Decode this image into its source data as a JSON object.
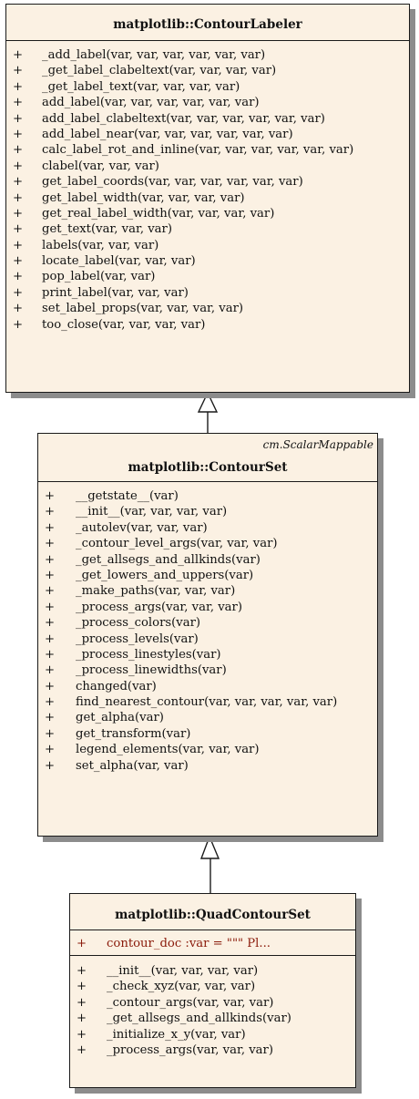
{
  "classes": {
    "contour_labeler": {
      "title": "matplotlib::ContourLabeler",
      "methods": [
        {
          "vis": "+",
          "sig": "_add_label(var, var, var, var, var, var)"
        },
        {
          "vis": "+",
          "sig": "_get_label_clabeltext(var, var, var, var)"
        },
        {
          "vis": "+",
          "sig": "_get_label_text(var, var, var, var)"
        },
        {
          "vis": "+",
          "sig": "add_label(var, var, var, var, var, var)"
        },
        {
          "vis": "+",
          "sig": "add_label_clabeltext(var, var, var, var, var, var)"
        },
        {
          "vis": "+",
          "sig": "add_label_near(var, var, var, var, var, var)"
        },
        {
          "vis": "+",
          "sig": "calc_label_rot_and_inline(var, var, var, var, var, var)"
        },
        {
          "vis": "+",
          "sig": "clabel(var, var, var)"
        },
        {
          "vis": "+",
          "sig": "get_label_coords(var, var, var, var, var, var)"
        },
        {
          "vis": "+",
          "sig": "get_label_width(var, var, var, var)"
        },
        {
          "vis": "+",
          "sig": "get_real_label_width(var, var, var, var)"
        },
        {
          "vis": "+",
          "sig": "get_text(var, var, var)"
        },
        {
          "vis": "+",
          "sig": "labels(var, var, var)"
        },
        {
          "vis": "+",
          "sig": "locate_label(var, var, var)"
        },
        {
          "vis": "+",
          "sig": "pop_label(var, var)"
        },
        {
          "vis": "+",
          "sig": "print_label(var, var, var)"
        },
        {
          "vis": "+",
          "sig": "set_label_props(var, var, var, var)"
        },
        {
          "vis": "+",
          "sig": "too_close(var, var, var, var)"
        }
      ]
    },
    "contour_set": {
      "stereotype": "cm.ScalarMappable",
      "title": "matplotlib::ContourSet",
      "methods": [
        {
          "vis": "+",
          "sig": "__getstate__(var)"
        },
        {
          "vis": "+",
          "sig": "__init__(var, var, var, var)"
        },
        {
          "vis": "+",
          "sig": "_autolev(var, var, var)"
        },
        {
          "vis": "+",
          "sig": "_contour_level_args(var, var, var)"
        },
        {
          "vis": "+",
          "sig": "_get_allsegs_and_allkinds(var)"
        },
        {
          "vis": "+",
          "sig": "_get_lowers_and_uppers(var)"
        },
        {
          "vis": "+",
          "sig": "_make_paths(var, var, var)"
        },
        {
          "vis": "+",
          "sig": "_process_args(var, var, var)"
        },
        {
          "vis": "+",
          "sig": "_process_colors(var)"
        },
        {
          "vis": "+",
          "sig": "_process_levels(var)"
        },
        {
          "vis": "+",
          "sig": "_process_linestyles(var)"
        },
        {
          "vis": "+",
          "sig": "_process_linewidths(var)"
        },
        {
          "vis": "+",
          "sig": "changed(var)"
        },
        {
          "vis": "+",
          "sig": "find_nearest_contour(var, var, var, var, var)"
        },
        {
          "vis": "+",
          "sig": "get_alpha(var)"
        },
        {
          "vis": "+",
          "sig": "get_transform(var)"
        },
        {
          "vis": "+",
          "sig": "legend_elements(var, var, var)"
        },
        {
          "vis": "+",
          "sig": "set_alpha(var, var)"
        }
      ]
    },
    "quad_contour_set": {
      "title": "matplotlib::QuadContourSet",
      "attributes": [
        {
          "vis": "+",
          "sig": "contour_doc  :var = \"\"\"        Pl..."
        }
      ],
      "methods": [
        {
          "vis": "+",
          "sig": "__init__(var, var, var, var)"
        },
        {
          "vis": "+",
          "sig": "_check_xyz(var, var, var)"
        },
        {
          "vis": "+",
          "sig": "_contour_args(var, var, var)"
        },
        {
          "vis": "+",
          "sig": "_get_allsegs_and_allkinds(var)"
        },
        {
          "vis": "+",
          "sig": "_initialize_x_y(var, var)"
        },
        {
          "vis": "+",
          "sig": "_process_args(var, var, var)"
        }
      ]
    }
  },
  "relations": [
    {
      "type": "inheritance",
      "from": "matplotlib::ContourSet",
      "to": "matplotlib::ContourLabeler"
    },
    {
      "type": "inheritance",
      "from": "matplotlib::QuadContourSet",
      "to": "matplotlib::ContourSet"
    }
  ]
}
